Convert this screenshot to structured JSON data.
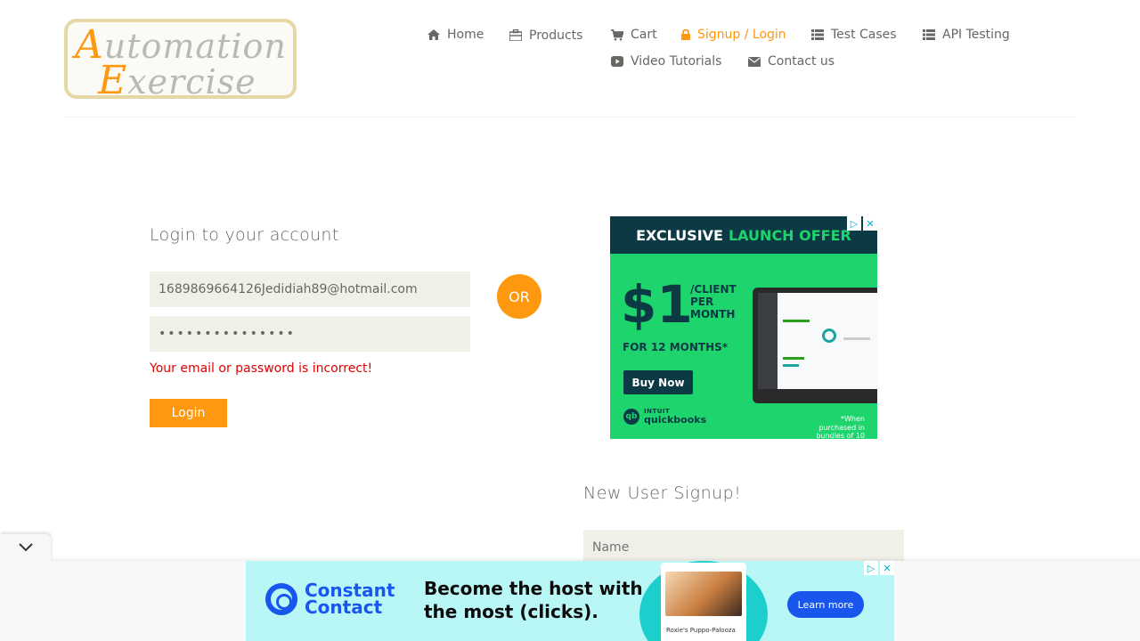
{
  "header": {
    "logo": {
      "line1_cap": "A",
      "line1_rest": "utomation",
      "line2_cap": "E",
      "line2_rest": "xercise"
    },
    "nav": {
      "home": "Home",
      "products": "Products",
      "cart": "Cart",
      "signup_login": "Signup / Login",
      "test_cases": "Test Cases",
      "api_testing": "API Testing",
      "video_tutorials": "Video Tutorials",
      "contact_us": "Contact us"
    },
    "active_item": "signup_login"
  },
  "login": {
    "title": "Login to your account",
    "email_value": "1689869664126Jedidiah89@hotmail.com",
    "password_value": "•••••••••••••••",
    "error": "Your email or password is incorrect!",
    "button": "Login"
  },
  "or_label": "OR",
  "signup": {
    "title": "New User Signup!",
    "name_placeholder": "Name"
  },
  "ad_right": {
    "band_white": "EXCLUSIVE",
    "band_green": "LAUNCH OFFER",
    "price": "$1",
    "per": "/CLIENT PER MONTH",
    "months": "FOR 12 MONTHS*",
    "cta": "Buy Now",
    "brand_top": "INTUIT",
    "brand": "quickbooks",
    "note": "*When purchased in bundles of 10"
  },
  "ad_bottom": {
    "brand": "Constant Contact",
    "headline": "Become the host with the most (clicks).",
    "card_caption": "Roxie's Puppo-Palooza",
    "cta": "Learn more"
  },
  "colors": {
    "accent": "#fe980f",
    "error": "#e40000",
    "field_bg": "#f0f0e9",
    "qb_green": "#1ed46c",
    "cc_blue": "#1856ed"
  }
}
